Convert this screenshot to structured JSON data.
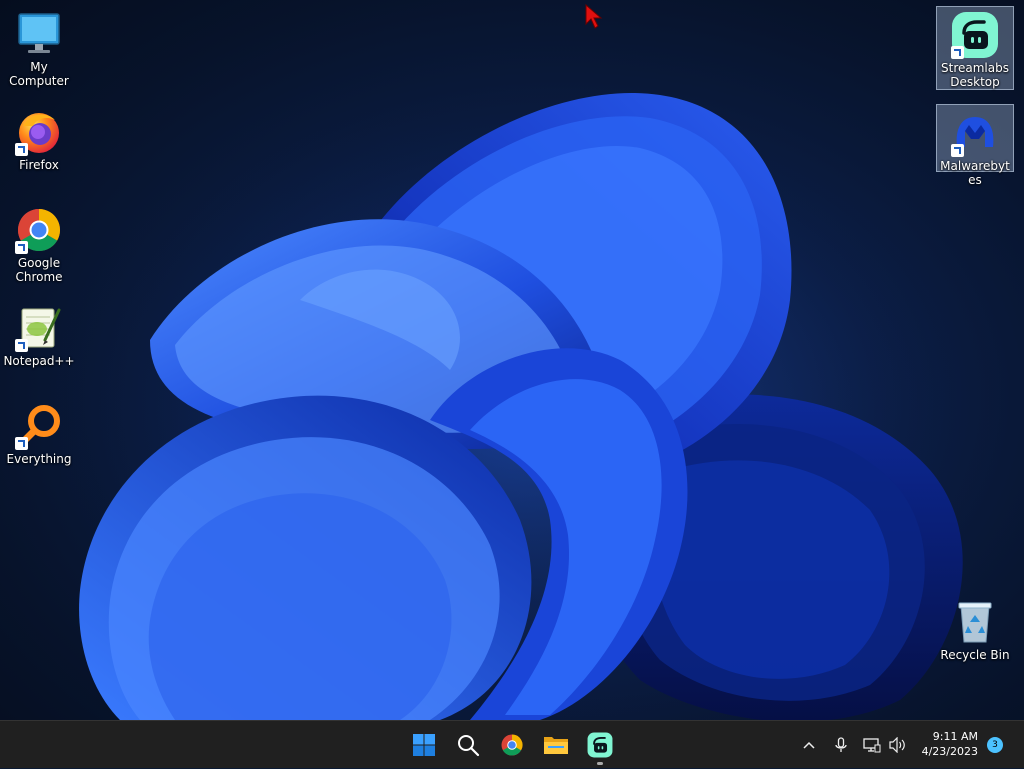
{
  "desktop": {
    "icons": [
      {
        "label": "My Computer",
        "icon": "monitor-icon"
      },
      {
        "label": "Firefox",
        "icon": "firefox-icon"
      },
      {
        "label": "Google Chrome",
        "icon": "chrome-icon"
      },
      {
        "label": "Notepad++",
        "icon": "notepadplusplus-icon"
      },
      {
        "label": "Everything",
        "icon": "everything-search-icon"
      },
      {
        "label": "Streamlabs Desktop",
        "icon": "streamlabs-icon"
      },
      {
        "label": "Malwarebytes",
        "icon": "malwarebytes-icon"
      },
      {
        "label": "Recycle Bin",
        "icon": "recycle-bin-icon"
      }
    ]
  },
  "taskbar": {
    "items": [
      {
        "name": "Start",
        "icon": "windows-start-icon"
      },
      {
        "name": "Search",
        "icon": "search-icon"
      },
      {
        "name": "Google Chrome",
        "icon": "chrome-icon"
      },
      {
        "name": "File Explorer",
        "icon": "folder-icon"
      },
      {
        "name": "Streamlabs Desktop",
        "icon": "streamlabs-icon"
      }
    ],
    "tray": {
      "icons": [
        "chevron-up-icon",
        "microphone-icon",
        "network-icon",
        "volume-icon"
      ],
      "time": "9:11 AM",
      "date": "4/23/2023",
      "notification_count": "3"
    }
  },
  "colors": {
    "accent": "#0067c0",
    "streamlabs": "#80f5d2",
    "taskbar": "#202020"
  }
}
